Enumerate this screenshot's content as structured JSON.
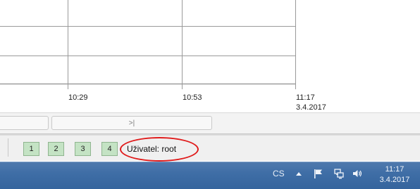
{
  "chart": {
    "x_ticks": [
      "10:29",
      "10:53",
      "11:17"
    ],
    "end_date": "3.4.2017"
  },
  "scroller": {
    "end_label": ">|"
  },
  "statusbar": {
    "pages": [
      "1",
      "2",
      "3",
      "4"
    ],
    "user_label": "Uživatel: root",
    "accent_color": "#e01b1b",
    "page_button_color": "#c4e3c4"
  },
  "taskbar": {
    "language": "CS",
    "tray_icons": [
      "show-hidden-icons-arrow-icon",
      "action-center-flag-icon",
      "network-icon",
      "volume-icon"
    ],
    "clock_time": "11:17",
    "clock_date": "3.4.2017"
  }
}
